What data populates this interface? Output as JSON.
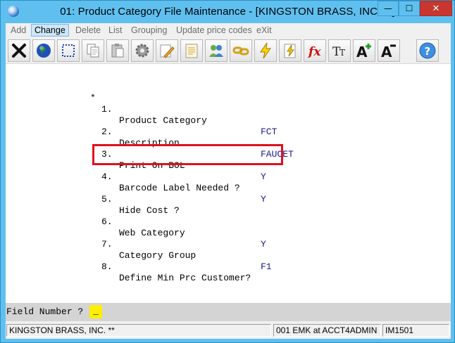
{
  "window": {
    "title": "01: Product Category File Maintenance - [KINGSTON BRASS, INC. **]",
    "minimize_glyph": "—",
    "maximize_glyph": "☐",
    "close_glyph": "✕"
  },
  "menu": [
    {
      "label": "Add",
      "active": false
    },
    {
      "label": "Change",
      "active": true
    },
    {
      "label": "Delete",
      "active": false
    },
    {
      "label": "List",
      "active": false
    },
    {
      "label": "Grouping",
      "active": false
    },
    {
      "label": "Update price codes",
      "active": false
    },
    {
      "label": "eXit",
      "active": false
    }
  ],
  "toolbar": [
    {
      "icon": "exit-x-icon"
    },
    {
      "icon": "globe-icon"
    },
    {
      "icon": "select-box-icon"
    },
    {
      "icon": "copy-icon"
    },
    {
      "icon": "paste-icon"
    },
    {
      "icon": "settings-gear-icon"
    },
    {
      "icon": "edit-pencil-icon"
    },
    {
      "icon": "notepad-icon"
    },
    {
      "icon": "users-icon"
    },
    {
      "icon": "chain-link-icon"
    },
    {
      "icon": "lightning-icon"
    },
    {
      "icon": "lightning-document-icon"
    },
    {
      "icon": "function-fx-icon"
    },
    {
      "icon": "text-size-icon"
    },
    {
      "icon": "increase-font-icon"
    },
    {
      "icon": "decrease-font-icon"
    },
    {
      "icon": "help-icon"
    }
  ],
  "fields": [
    {
      "marker": "*",
      "number": "1.",
      "label": "Product Category",
      "value": "FCT"
    },
    {
      "marker": "",
      "number": "2.",
      "label": "Description",
      "value": "FAUCET"
    },
    {
      "marker": "",
      "number": "3.",
      "label": "Print On BOL",
      "value": "Y"
    },
    {
      "marker": "",
      "number": "4.",
      "label": "Barcode Label Needed ?",
      "value": "Y"
    },
    {
      "marker": "",
      "number": "5.",
      "label": "Hide Cost ?",
      "value": ""
    },
    {
      "marker": "",
      "number": "6.",
      "label": "Web Category",
      "value": "Y"
    },
    {
      "marker": "",
      "number": "7.",
      "label": "Category Group",
      "value": "F1"
    },
    {
      "marker": "",
      "number": "8.",
      "label": "Define Min Prc Customer?",
      "value": ""
    }
  ],
  "prompt": {
    "label": "Field Number ?",
    "value": "_"
  },
  "status": {
    "company": "KINGSTON BRASS, INC. **",
    "user": "001 EMK at ACCT4ADMIN",
    "program": "IM1501"
  },
  "colors": {
    "highlight_border": "#e0101e",
    "input_background": "#ffee00",
    "value_text": "#1a1a8f",
    "title_bar": "#5fc0f0"
  }
}
